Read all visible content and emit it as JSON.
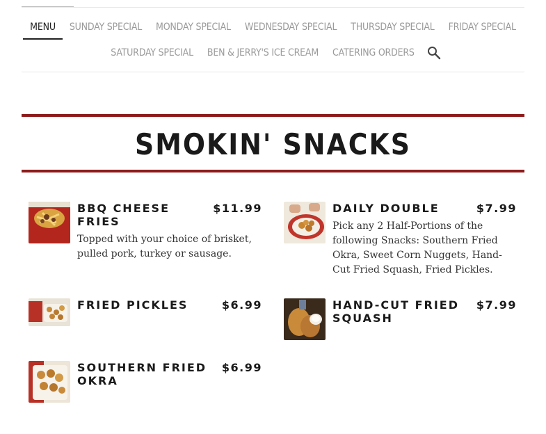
{
  "nav": {
    "row1": [
      "MENU",
      "SUNDAY SPECIAL",
      "MONDAY SPECIAL",
      "WEDNESDAY SPECIAL",
      "THURSDAY SPECIAL",
      "FRIDAY SPECIAL"
    ],
    "row2": [
      "SATURDAY SPECIAL",
      "BEN & JERRY'S ICE CREAM",
      "CATERING ORDERS"
    ],
    "active": "MENU",
    "search_icon": "search-icon"
  },
  "section": {
    "title": "SMOKIN' SNACKS"
  },
  "items": [
    {
      "name": "BBQ CHEESE FRIES",
      "price": "$11.99",
      "description": "Topped with your choice of brisket, pulled pork, turkey or sausage."
    },
    {
      "name": "DAILY DOUBLE",
      "price": "$7.99",
      "description": "Pick any 2 Half-Portions of the following Snacks: Southern Fried Okra, Sweet Corn Nuggets, Hand-Cut Fried Squash, Fried Pickles."
    },
    {
      "name": "FRIED PICKLES",
      "price": "$6.99",
      "description": ""
    },
    {
      "name": "HAND-CUT FRIED SQUASH",
      "price": "$7.99",
      "description": ""
    },
    {
      "name": "SOUTHERN FRIED OKRA",
      "price": "$6.99",
      "description": ""
    }
  ],
  "colors": {
    "accent_band": "#8e1b1b",
    "nav_text": "#9a9a9a",
    "nav_active": "#222222"
  }
}
